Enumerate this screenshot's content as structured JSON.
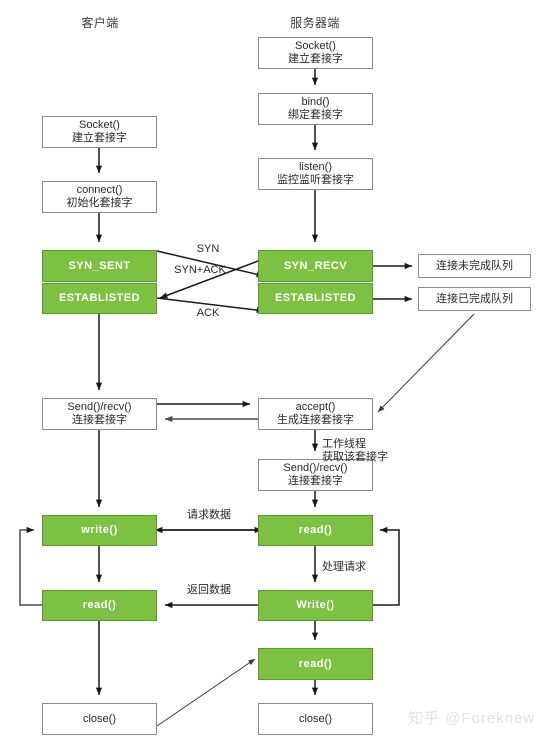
{
  "diagram": {
    "title_client": "客户端",
    "title_server": "服务器端",
    "watermark": "知乎 @Foreknew",
    "colors": {
      "green_fill": "#7cc142",
      "green_border": "#5b9a2c",
      "box_border": "#8b8b8b",
      "text": "#2a2a2a",
      "line": "#1a1a1a"
    }
  },
  "client_nodes": [
    {
      "id": "c-socket",
      "line1": "Socket()",
      "line2": "建立套接字",
      "style": "plain"
    },
    {
      "id": "c-connect",
      "line1": "connect()",
      "line2": "初始化套接字",
      "style": "plain"
    },
    {
      "id": "c-synsent",
      "line1": "SYN_SENT",
      "line2": "",
      "style": "green"
    },
    {
      "id": "c-estab",
      "line1": "ESTABLISTED",
      "line2": "",
      "style": "green"
    },
    {
      "id": "c-sendrecv",
      "line1": "Send()/recv()",
      "line2": "连接套接字",
      "style": "plain"
    },
    {
      "id": "c-write",
      "line1": "write()",
      "line2": "",
      "style": "green"
    },
    {
      "id": "c-read",
      "line1": "read()",
      "line2": "",
      "style": "green"
    },
    {
      "id": "c-close",
      "line1": "close()",
      "line2": "",
      "style": "plain"
    }
  ],
  "server_nodes": [
    {
      "id": "s-socket",
      "line1": "Socket()",
      "line2": "建立套接字",
      "style": "plain"
    },
    {
      "id": "s-bind",
      "line1": "bind()",
      "line2": "绑定套接字",
      "style": "plain"
    },
    {
      "id": "s-listen",
      "line1": "listen()",
      "line2": "监控监听套接字",
      "style": "plain"
    },
    {
      "id": "s-synrecv",
      "line1": "SYN_RECV",
      "line2": "",
      "style": "green"
    },
    {
      "id": "s-estab",
      "line1": "ESTABLISTED",
      "line2": "",
      "style": "green"
    },
    {
      "id": "s-accept",
      "line1": "accept()",
      "line2": "生成连接套接字",
      "style": "plain"
    },
    {
      "id": "s-sendrecv",
      "line1": "Send()/recv()",
      "line2": "连接套接字",
      "style": "plain"
    },
    {
      "id": "s-read1",
      "line1": "read()",
      "line2": "",
      "style": "green"
    },
    {
      "id": "s-write",
      "line1": "Write()",
      "line2": "",
      "style": "green"
    },
    {
      "id": "s-read2",
      "line1": "read()",
      "line2": "",
      "style": "green"
    },
    {
      "id": "s-close",
      "line1": "close()",
      "line2": "",
      "style": "plain"
    }
  ],
  "queue_nodes": [
    {
      "id": "q-incomplete",
      "line1": "连接未完成队列",
      "line2": "",
      "style": "plain"
    },
    {
      "id": "q-complete",
      "line1": "连接已完成队列",
      "line2": "",
      "style": "plain"
    }
  ],
  "edge_labels": [
    {
      "id": "lbl-syn",
      "text": "SYN"
    },
    {
      "id": "lbl-synack",
      "text": "SYN+ACK"
    },
    {
      "id": "lbl-ack",
      "text": "ACK"
    },
    {
      "id": "lbl-worker1",
      "text": "工作线程"
    },
    {
      "id": "lbl-worker2",
      "text": "获取该套接字"
    },
    {
      "id": "lbl-request",
      "text": "请求数据"
    },
    {
      "id": "lbl-response",
      "text": "返回数据"
    },
    {
      "id": "lbl-handle",
      "text": "处理请求"
    }
  ]
}
